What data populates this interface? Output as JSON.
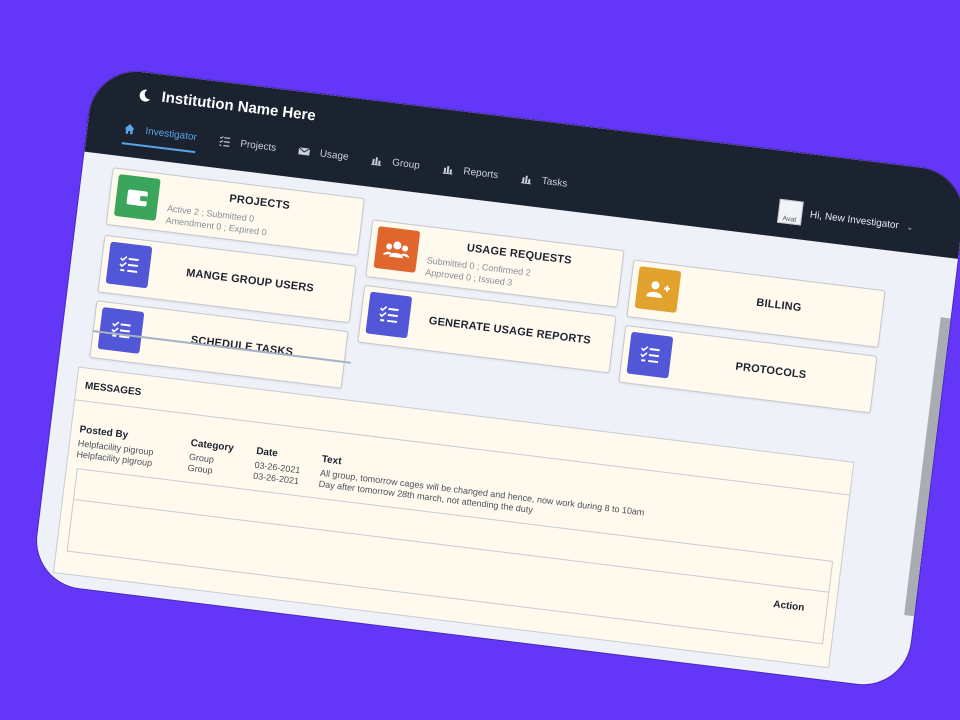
{
  "header": {
    "brand": "Institution Name Here",
    "nav": [
      {
        "label": "Investigator",
        "icon": "home-icon",
        "active": true
      },
      {
        "label": "Projects",
        "icon": "list-check-icon"
      },
      {
        "label": "Usage",
        "icon": "envelope-icon"
      },
      {
        "label": "Group",
        "icon": "bar-chart-icon"
      },
      {
        "label": "Reports",
        "icon": "bar-chart-icon"
      },
      {
        "label": "Tasks",
        "icon": "bar-chart-icon"
      }
    ],
    "avatar_alt": "Avat",
    "user_greeting": "Hi, New Investigator"
  },
  "cards": {
    "projects": {
      "title": "PROJECTS",
      "line1": "Active 2 ; Submitted 0",
      "line2": "Amendment 0 ; Expired 0",
      "icon": "wallet-icon",
      "color": "#3aa55b"
    },
    "usage_requests": {
      "title": "USAGE REQUESTS",
      "line1": "Submitted 0 ; Confirmed 2",
      "line2": "Approved 0 ; Issued 3",
      "icon": "users-icon",
      "color": "#e0662d"
    },
    "billing": {
      "title": "BILLING",
      "icon": "user-plus-icon",
      "color": "#e2a32e"
    },
    "manage_group_users": {
      "title": "MANGE GROUP USERS",
      "icon": "list-check-icon",
      "color": "#5157d6"
    },
    "generate_usage_reports": {
      "title": "GENERATE USAGE REPORTS",
      "icon": "list-check-icon",
      "color": "#5157d6"
    },
    "protocols": {
      "title": "PROTOCOLS",
      "icon": "list-check-icon",
      "color": "#5157d6"
    },
    "schedule_tasks": {
      "title": "SCHEDULE TASKS",
      "icon": "list-check-icon",
      "color": "#5157d6"
    }
  },
  "messages": {
    "title": "MESSAGES",
    "columns": {
      "posted_by": "Posted By",
      "category": "Category",
      "date": "Date",
      "text": "Text",
      "action": "Action"
    },
    "rows": [
      {
        "posted_by": "Helpfacility pigroup",
        "category": "Group",
        "date": "03-26-2021",
        "text": "All group, tomorrow cages will be changed and hence, now work during 8 to 10am"
      },
      {
        "posted_by": "Helpfacility pigroup",
        "category": "Group",
        "date": "03-26-2021",
        "text": "Day after tomorrow 28th march, not attending the duty"
      }
    ]
  }
}
